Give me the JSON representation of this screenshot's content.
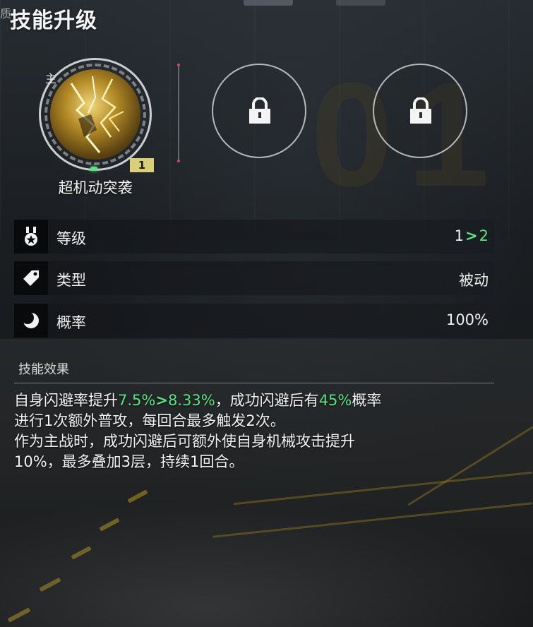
{
  "header": {
    "title": "技能升级",
    "edge_text": "质"
  },
  "skill_slots": {
    "main": {
      "tag": "主",
      "name": "超机动突袭",
      "level_badge": "1"
    },
    "locked": [
      {
        "icon": "lock-icon"
      },
      {
        "icon": "lock-icon"
      }
    ]
  },
  "stats": {
    "level": {
      "label": "等级",
      "icon": "medal-icon",
      "current": "1",
      "arrow": ">",
      "next": "2"
    },
    "type": {
      "label": "类型",
      "icon": "tag-icon",
      "value": "被动"
    },
    "rate": {
      "label": "概率",
      "icon": "moon-icon",
      "value": "100%"
    }
  },
  "effect": {
    "heading": "技能效果",
    "line1_prefix": "自身闪避率提升",
    "line1_old": "7.5%",
    "line1_arrow": ">",
    "line1_new": "8.33%",
    "line1_mid": "，成功闪避后有",
    "line1_chance": "45%",
    "line1_suffix": "概率",
    "line2": "进行1次额外普攻，每回合最多触发2次。",
    "line3": "作为主战时，成功闪避后可额外使自身机械攻击提升",
    "line4": "10%，最多叠加3层，持续1回合。"
  },
  "colors": {
    "highlight": "#5de384",
    "badge": "#d9cf7a",
    "text": "#f2f2f2"
  }
}
